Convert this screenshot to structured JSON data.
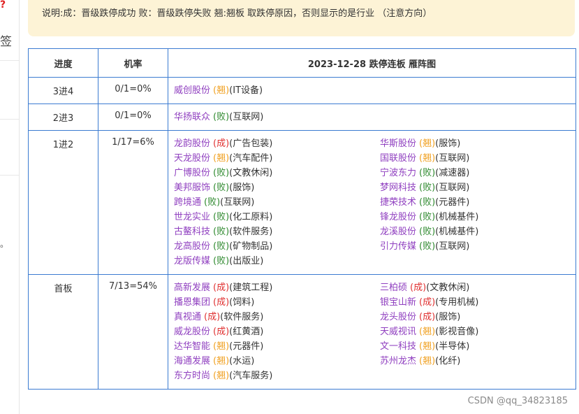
{
  "side": {
    "corner_mark": "?",
    "side_char": "签",
    "stray_char": "。"
  },
  "notice": {
    "text": "说明:成：晋级跌停成功 败：晋级跌停失败 翘:翘板 取跌停原因，否则显示的是行业 （注意方向）"
  },
  "table": {
    "headers": {
      "progress": "进度",
      "rate": "机率",
      "title": "2023-12-28 跌停连板 雁阵图"
    },
    "rows": [
      {
        "progress": "3进4",
        "rate": "0/1=0%",
        "stocks": [
          {
            "name": "威创股份",
            "status": "(翘)",
            "type": "qiao",
            "industry": "(IT设备)"
          }
        ]
      },
      {
        "progress": "2进3",
        "rate": "0/1=0%",
        "stocks": [
          {
            "name": "华扬联众",
            "status": "(败)",
            "type": "bai",
            "industry": "(互联网)"
          }
        ]
      },
      {
        "progress": "1进2",
        "rate": "1/17=6%",
        "stocks": [
          {
            "name": "龙韵股份",
            "status": "(成)",
            "type": "cheng",
            "industry": "(广告包装)"
          },
          {
            "name": "华斯股份",
            "status": "(翘)",
            "type": "qiao",
            "industry": "(服饰)"
          },
          {
            "name": "天龙股份",
            "status": "(翘)",
            "type": "qiao",
            "industry": "(汽车配件)"
          },
          {
            "name": "国联股份",
            "status": "(翘)",
            "type": "qiao",
            "industry": "(互联网)"
          },
          {
            "name": "广博股份",
            "status": "(败)",
            "type": "bai",
            "industry": "(文教休闲)"
          },
          {
            "name": "宁波东力",
            "status": "(败)",
            "type": "bai",
            "industry": "(减速器)"
          },
          {
            "name": "美邦服饰",
            "status": "(败)",
            "type": "bai",
            "industry": "(服饰)"
          },
          {
            "name": "梦网科技",
            "status": "(败)",
            "type": "bai",
            "industry": "(互联网)"
          },
          {
            "name": "跨境通",
            "status": "(败)",
            "type": "bai",
            "industry": "(互联网)"
          },
          {
            "name": "捷荣技术",
            "status": "(败)",
            "type": "bai",
            "industry": "(元器件)"
          },
          {
            "name": "世龙实业",
            "status": "(败)",
            "type": "bai",
            "industry": "(化工原料)"
          },
          {
            "name": "锋龙股份",
            "status": "(败)",
            "type": "bai",
            "industry": "(机械基件)"
          },
          {
            "name": "古鳌科技",
            "status": "(败)",
            "type": "bai",
            "industry": "(软件服务)"
          },
          {
            "name": "龙溪股份",
            "status": "(败)",
            "type": "bai",
            "industry": "(机械基件)"
          },
          {
            "name": "龙高股份",
            "status": "(败)",
            "type": "bai",
            "industry": "(矿物制品)"
          },
          {
            "name": "引力传媒",
            "status": "(败)",
            "type": "bai",
            "industry": "(互联网)"
          },
          {
            "name": "龙版传媒",
            "status": "(败)",
            "type": "bai",
            "industry": "(出版业)"
          }
        ]
      },
      {
        "progress": "首板",
        "rate": "7/13=54%",
        "stocks": [
          {
            "name": "高新发展",
            "status": "(成)",
            "type": "cheng",
            "industry": "(建筑工程)"
          },
          {
            "name": "三柏硕",
            "status": "(成)",
            "type": "cheng",
            "industry": "(文教休闲)"
          },
          {
            "name": "播恩集团",
            "status": "(成)",
            "type": "cheng",
            "industry": "(饲料)"
          },
          {
            "name": "银宝山新",
            "status": "(成)",
            "type": "cheng",
            "industry": "(专用机械)"
          },
          {
            "name": "真视通",
            "status": "(成)",
            "type": "cheng",
            "industry": "(软件服务)"
          },
          {
            "name": "龙头股份",
            "status": "(成)",
            "type": "cheng",
            "industry": "(服饰)"
          },
          {
            "name": "威龙股份",
            "status": "(成)",
            "type": "cheng",
            "industry": "(红黄酒)"
          },
          {
            "name": "天威视讯",
            "status": "(翘)",
            "type": "qiao",
            "industry": "(影视音像)"
          },
          {
            "name": "达华智能",
            "status": "(翘)",
            "type": "qiao",
            "industry": "(元器件)"
          },
          {
            "name": "文一科技",
            "status": "(翘)",
            "type": "qiao",
            "industry": "(半导体)"
          },
          {
            "name": "海通发展",
            "status": "(翘)",
            "type": "qiao",
            "industry": "(水运)"
          },
          {
            "name": "苏州龙杰",
            "status": "(翘)",
            "type": "qiao",
            "industry": "(化纤)"
          },
          {
            "name": "东方时尚",
            "status": "(翘)",
            "type": "qiao",
            "industry": "(汽车服务)"
          }
        ]
      }
    ]
  },
  "watermark": "CSDN @qq_34823185",
  "colors": {
    "name": "#9040c0",
    "cheng": "#e03030",
    "bai": "#2f8a2f",
    "qiao": "#f0a020",
    "border": "#3b7bd1",
    "notice_bg": "#fdf3d6"
  }
}
